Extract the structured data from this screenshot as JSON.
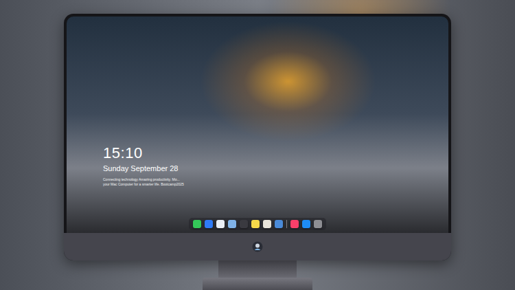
{
  "screen": {
    "lock_screen": {
      "time": "15:10",
      "date": "Sunday September 28",
      "caption": [
        "Connecting technology Amazing productivity. Mo...",
        "your Mac Computer for a smarter life. Bootcamp2025"
      ]
    },
    "dock": {
      "apps": [
        {
          "color": "#34c759"
        },
        {
          "color": "#2f7bf6"
        },
        {
          "color": "#e9eef5"
        },
        {
          "color": "#7fb2e8"
        },
        {
          "color": "#3a3a40"
        },
        {
          "color": "#f6d94a"
        },
        {
          "color": "#e8e4da"
        },
        {
          "color": "#4a8ad8"
        }
      ],
      "pinned": [
        {
          "color": "#fa3f6a"
        },
        {
          "color": "#1e8cf5"
        },
        {
          "color": "#8e8e93"
        }
      ]
    }
  }
}
